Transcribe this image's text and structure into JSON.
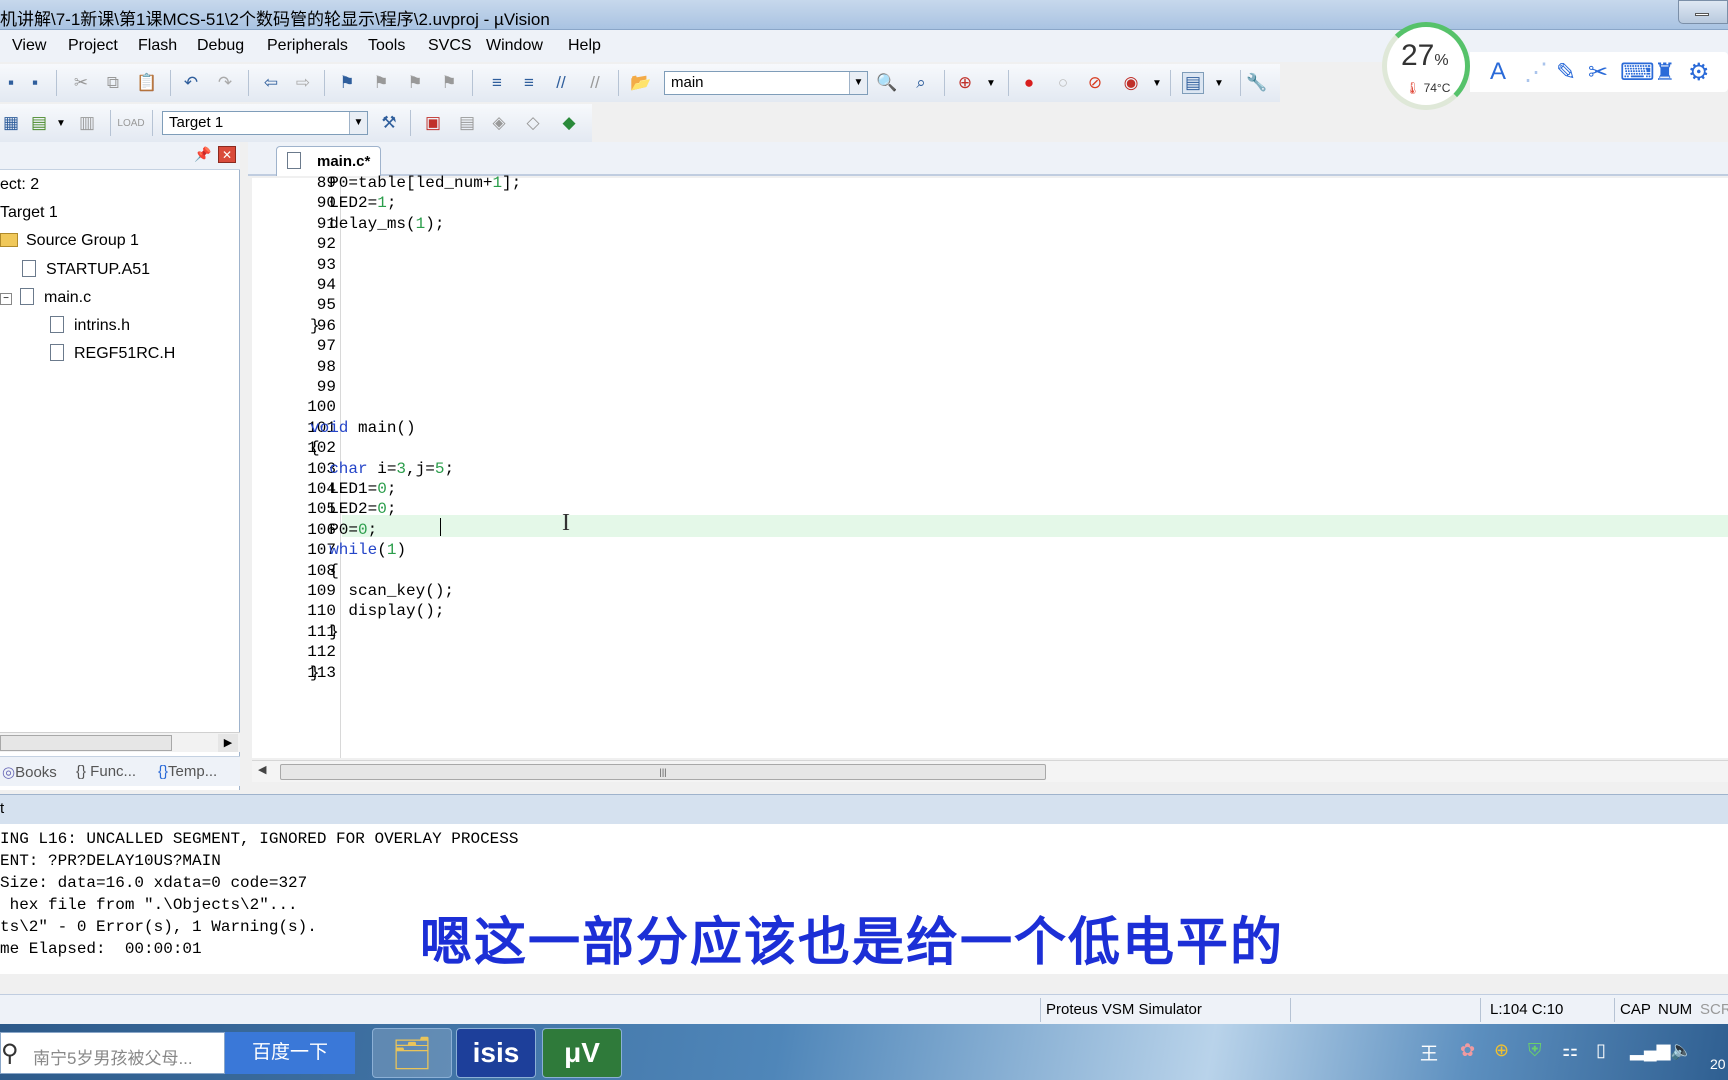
{
  "window": {
    "title": "机讲解\\7-1新课\\第1课MCS-51\\2个数码管的轮显示\\程序\\2.uvproj - µVision"
  },
  "menu": [
    "View",
    "Project",
    "Flash",
    "Debug",
    "Peripherals",
    "Tools",
    "SVCS",
    "Window",
    "Help"
  ],
  "toolbar": {
    "find_combo": "main",
    "target_combo": "Target 1"
  },
  "project": {
    "root": "ect: 2",
    "target": "Target 1",
    "group": "Source Group 1",
    "files": [
      "STARTUP.A51",
      "main.c",
      "intrins.h",
      "REGF51RC.H"
    ],
    "tabs": [
      "Books",
      "{} Func...",
      "Temp..."
    ]
  },
  "editor": {
    "tab_label": "main.c*",
    "line_numbers": [
      "89",
      "90",
      "91",
      "92",
      "93",
      "94",
      "95",
      "96",
      "97",
      "98",
      "99",
      "100",
      "101",
      "102",
      "103",
      "104",
      "105",
      "106",
      "107",
      "108",
      "109",
      "110",
      "111",
      "112",
      "113"
    ],
    "code": [
      "  P0=table[led_num+1];",
      "  LED2=1;",
      "  delay_ms(1);",
      "",
      "",
      "",
      "",
      "}",
      "",
      "",
      "",
      "",
      "void main()",
      "{",
      "  char i=3,j=5;",
      "  LED1=0;",
      "  LED2=0;",
      "  P0=0;",
      "  while(1)",
      "  {",
      "    scan_key();",
      "    display();",
      "  }",
      "",
      "}"
    ]
  },
  "output": {
    "header": "t",
    "lines": [
      "ING L16: UNCALLED SEGMENT, IGNORED FOR OVERLAY PROCESS",
      "ENT: ?PR?DELAY10US?MAIN",
      "Size: data=16.0 xdata=0 code=327",
      " hex file from \".\\Objects\\2\"...",
      "ts\\2\" - 0 Error(s), 1 Warning(s).",
      "me Elapsed:  00:00:01"
    ],
    "subtitle": "嗯这一部分应该也是给一个低电平的"
  },
  "status": {
    "debugger": "Proteus VSM Simulator",
    "position": "L:104 C:10",
    "cap": "CAP",
    "num": "NUM",
    "scrl": "SCR"
  },
  "taskbar": {
    "search_placeholder": "南宁5岁男孩被父母...",
    "search_button": "百度一下",
    "apps": [
      "isis"
    ],
    "clock_partial": "20"
  },
  "widget": {
    "cpu_percent": "27",
    "percent_sign": "%",
    "temperature": "74°C"
  }
}
